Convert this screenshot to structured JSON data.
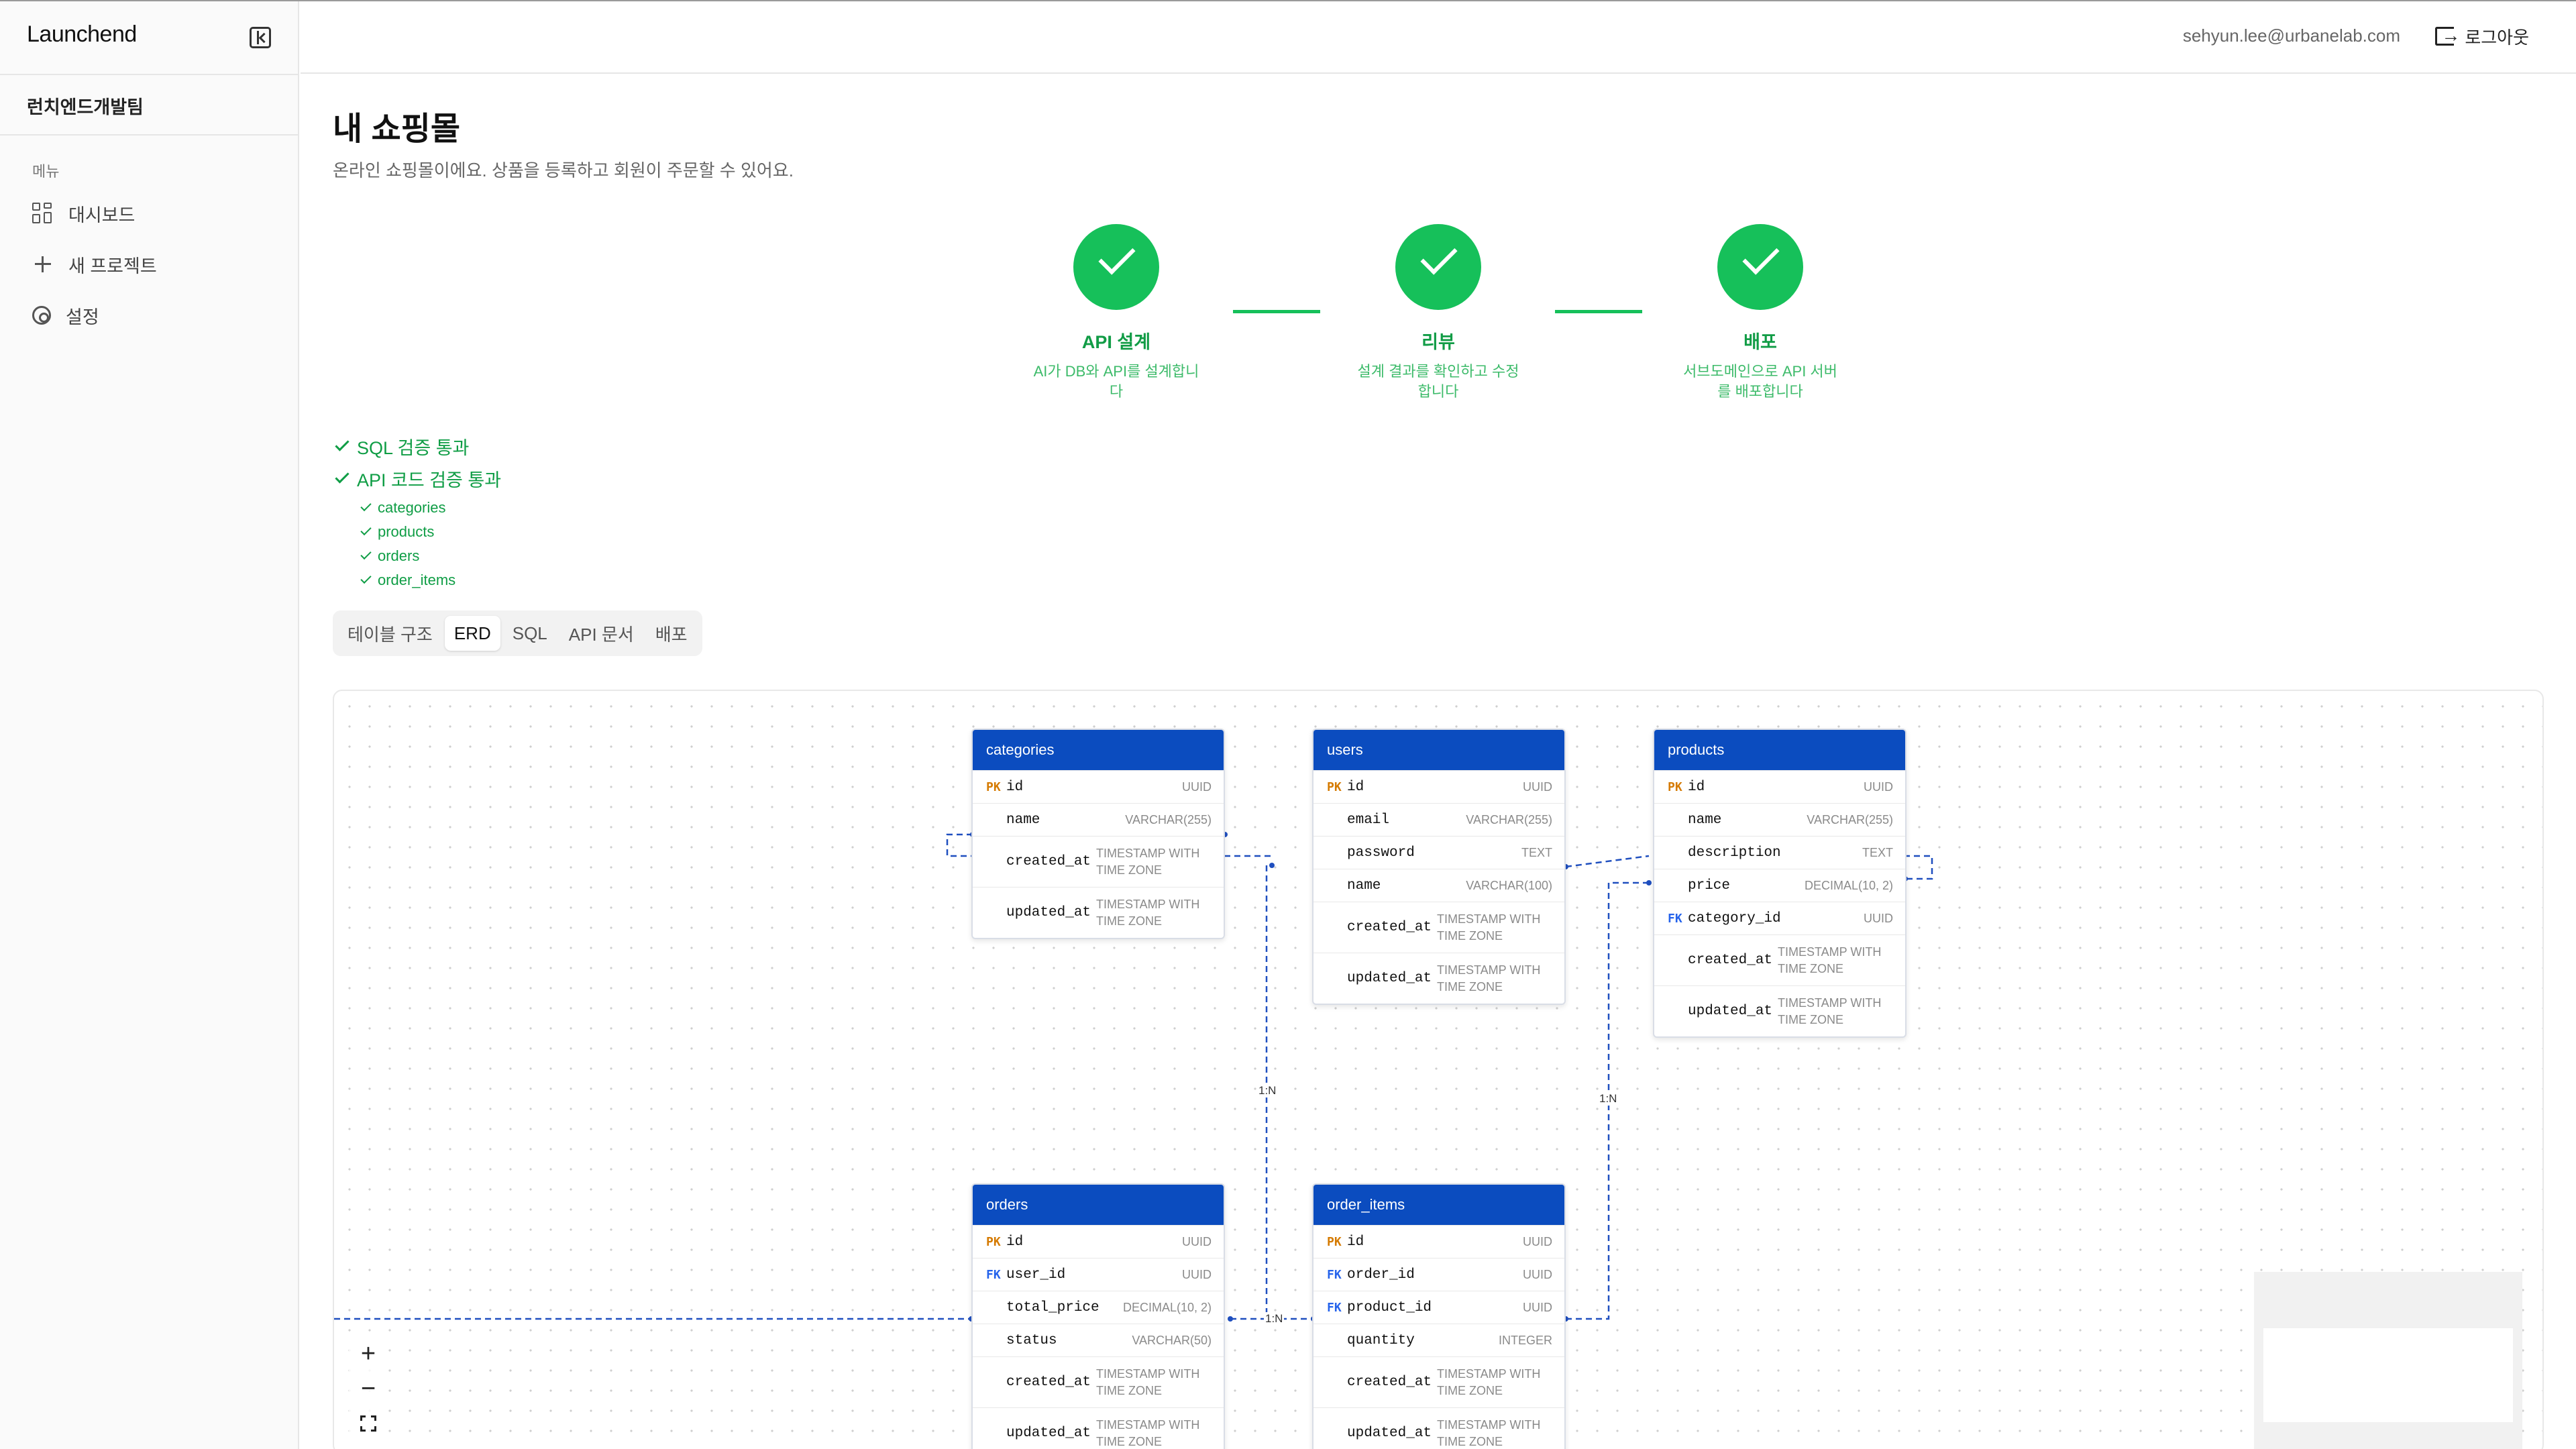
{
  "app": {
    "brand": "Launchend",
    "team": "런치엔드개발팀"
  },
  "sidebar": {
    "menu_heading": "메뉴",
    "items": [
      {
        "label": "대시보드",
        "icon": "grid-icon"
      },
      {
        "label": "새 프로젝트",
        "icon": "plus-icon"
      },
      {
        "label": "설정",
        "icon": "gear-icon"
      }
    ]
  },
  "header": {
    "email": "sehyun.lee@urbanelab.com",
    "logout_label": "로그아웃"
  },
  "page": {
    "title": "내 쇼핑몰",
    "subtitle": "온라인 쇼핑몰이에요. 상품을 등록하고 회원이 주문할 수 있어요."
  },
  "steps": [
    {
      "title": "API 설계",
      "desc": "AI가 DB와 API를 설계합니다",
      "status": "complete"
    },
    {
      "title": "리뷰",
      "desc": "설계 결과를 확인하고 수정합니다",
      "status": "complete"
    },
    {
      "title": "배포",
      "desc": "서브도메인으로 API 서버를 배포합니다",
      "status": "complete"
    }
  ],
  "validation": {
    "sql": "SQL 검증 통과",
    "api": "API 코드 검증 통과",
    "api_items": [
      "categories",
      "products",
      "orders",
      "order_items"
    ]
  },
  "tabs": [
    {
      "label": "테이블 구조",
      "active": false
    },
    {
      "label": "ERD",
      "active": true
    },
    {
      "label": "SQL",
      "active": false
    },
    {
      "label": "API 문서",
      "active": false
    },
    {
      "label": "배포",
      "active": false
    }
  ],
  "erd": {
    "tables": [
      {
        "name": "categories",
        "columns": [
          {
            "key": "PK",
            "name": "id",
            "type": "UUID"
          },
          {
            "key": "",
            "name": "name",
            "type": "VARCHAR(255)"
          },
          {
            "key": "",
            "name": "created_at",
            "type": "TIMESTAMP WITH TIME ZONE"
          },
          {
            "key": "",
            "name": "updated_at",
            "type": "TIMESTAMP WITH TIME ZONE"
          }
        ]
      },
      {
        "name": "users",
        "columns": [
          {
            "key": "PK",
            "name": "id",
            "type": "UUID"
          },
          {
            "key": "",
            "name": "email",
            "type": "VARCHAR(255)"
          },
          {
            "key": "",
            "name": "password",
            "type": "TEXT"
          },
          {
            "key": "",
            "name": "name",
            "type": "VARCHAR(100)"
          },
          {
            "key": "",
            "name": "created_at",
            "type": "TIMESTAMP WITH TIME ZONE"
          },
          {
            "key": "",
            "name": "updated_at",
            "type": "TIMESTAMP WITH TIME ZONE"
          }
        ]
      },
      {
        "name": "products",
        "columns": [
          {
            "key": "PK",
            "name": "id",
            "type": "UUID"
          },
          {
            "key": "",
            "name": "name",
            "type": "VARCHAR(255)"
          },
          {
            "key": "",
            "name": "description",
            "type": "TEXT"
          },
          {
            "key": "",
            "name": "price",
            "type": "DECIMAL(10, 2)"
          },
          {
            "key": "FK",
            "name": "category_id",
            "type": "UUID"
          },
          {
            "key": "",
            "name": "created_at",
            "type": "TIMESTAMP WITH TIME ZONE"
          },
          {
            "key": "",
            "name": "updated_at",
            "type": "TIMESTAMP WITH TIME ZONE"
          }
        ]
      },
      {
        "name": "orders",
        "columns": [
          {
            "key": "PK",
            "name": "id",
            "type": "UUID"
          },
          {
            "key": "FK",
            "name": "user_id",
            "type": "UUID"
          },
          {
            "key": "",
            "name": "total_price",
            "type": "DECIMAL(10, 2)"
          },
          {
            "key": "",
            "name": "status",
            "type": "VARCHAR(50)"
          },
          {
            "key": "",
            "name": "created_at",
            "type": "TIMESTAMP WITH TIME ZONE"
          },
          {
            "key": "",
            "name": "updated_at",
            "type": "TIMESTAMP WITH TIME ZONE"
          }
        ]
      },
      {
        "name": "order_items",
        "columns": [
          {
            "key": "PK",
            "name": "id",
            "type": "UUID"
          },
          {
            "key": "FK",
            "name": "order_id",
            "type": "UUID"
          },
          {
            "key": "FK",
            "name": "product_id",
            "type": "UUID"
          },
          {
            "key": "",
            "name": "quantity",
            "type": "INTEGER"
          },
          {
            "key": "",
            "name": "created_at",
            "type": "TIMESTAMP WITH TIME ZONE"
          },
          {
            "key": "",
            "name": "updated_at",
            "type": "TIMESTAMP WITH TIME ZONE"
          }
        ]
      }
    ],
    "relation_labels": [
      "1:N",
      "1:N",
      "1:N"
    ],
    "edge_color": "#1f4fbf",
    "header_color": "#0b4cbf"
  },
  "zoom_controls": [
    "+",
    "−"
  ]
}
